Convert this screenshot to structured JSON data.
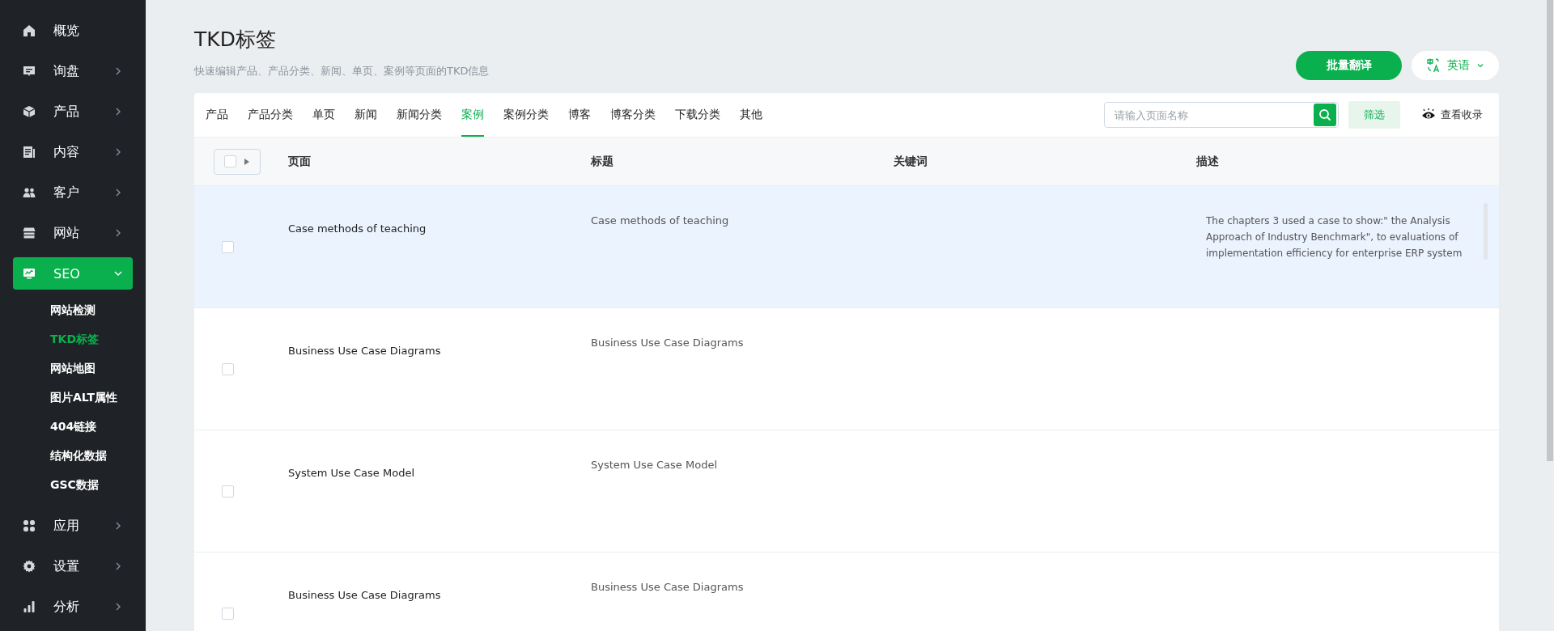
{
  "sidebar": {
    "items": [
      {
        "label": "概览",
        "has_arrow": false,
        "selected": false
      },
      {
        "label": "询盘",
        "has_arrow": true,
        "selected": false,
        "expanded": false
      },
      {
        "label": "产品",
        "has_arrow": true,
        "selected": false,
        "expanded": false
      },
      {
        "label": "内容",
        "has_arrow": true,
        "selected": false,
        "expanded": false
      },
      {
        "label": "客户",
        "has_arrow": true,
        "selected": false,
        "expanded": false
      },
      {
        "label": "网站",
        "has_arrow": true,
        "selected": false,
        "expanded": false
      },
      {
        "label": "SEO",
        "has_arrow": true,
        "selected": true,
        "expanded": true,
        "children": [
          {
            "label": "网站检测",
            "selected": false
          },
          {
            "label": "TKD标签",
            "selected": true
          },
          {
            "label": "网站地图",
            "selected": false
          },
          {
            "label": "图片ALT属性",
            "selected": false
          },
          {
            "label": "404链接",
            "selected": false
          },
          {
            "label": "结构化数据",
            "selected": false
          },
          {
            "label": "GSC数据",
            "selected": false
          }
        ]
      },
      {
        "label": "应用",
        "has_arrow": true,
        "selected": false,
        "expanded": false
      },
      {
        "label": "设置",
        "has_arrow": true,
        "selected": false,
        "expanded": false
      },
      {
        "label": "分析",
        "has_arrow": true,
        "selected": false,
        "expanded": false
      }
    ]
  },
  "header": {
    "title": "TKD标签",
    "subtitle": "快速编辑产品、产品分类、新闻、单页、案例等页面的TKD信息",
    "batch_button": "批量翻译",
    "language": "英语"
  },
  "tabs": [
    {
      "label": "产品",
      "selected": false
    },
    {
      "label": "产品分类",
      "selected": false
    },
    {
      "label": "单页",
      "selected": false
    },
    {
      "label": "新闻",
      "selected": false
    },
    {
      "label": "新闻分类",
      "selected": false
    },
    {
      "label": "案例",
      "selected": true
    },
    {
      "label": "案例分类",
      "selected": false
    },
    {
      "label": "博客",
      "selected": false
    },
    {
      "label": "博客分类",
      "selected": false
    },
    {
      "label": "下载分类",
      "selected": false
    },
    {
      "label": "其他",
      "selected": false
    }
  ],
  "search": {
    "placeholder": "请输入页面名称"
  },
  "filter_button": "筛选",
  "view_index_link": "查看收录",
  "table": {
    "columns": [
      "页面",
      "标题",
      "关键词",
      "描述"
    ],
    "rows": [
      {
        "page": "Case methods of teaching",
        "title": "Case methods of teaching",
        "description": "The chapters 3 used a case to show:\" the Analysis Approach of Industry Benchmark\", to evaluations of implementation efficiency for enterprise ERP system",
        "checked": false,
        "highlighted": true
      },
      {
        "page": "Business Use Case Diagrams",
        "title": "Business Use Case Diagrams",
        "checked": false,
        "highlighted": false
      },
      {
        "page": "System Use Case Model",
        "title": "System Use Case Model",
        "checked": false,
        "highlighted": false
      },
      {
        "page": "Business Use Case Diagrams",
        "title": "Business Use Case Diagrams",
        "checked": false,
        "highlighted": false
      }
    ]
  }
}
